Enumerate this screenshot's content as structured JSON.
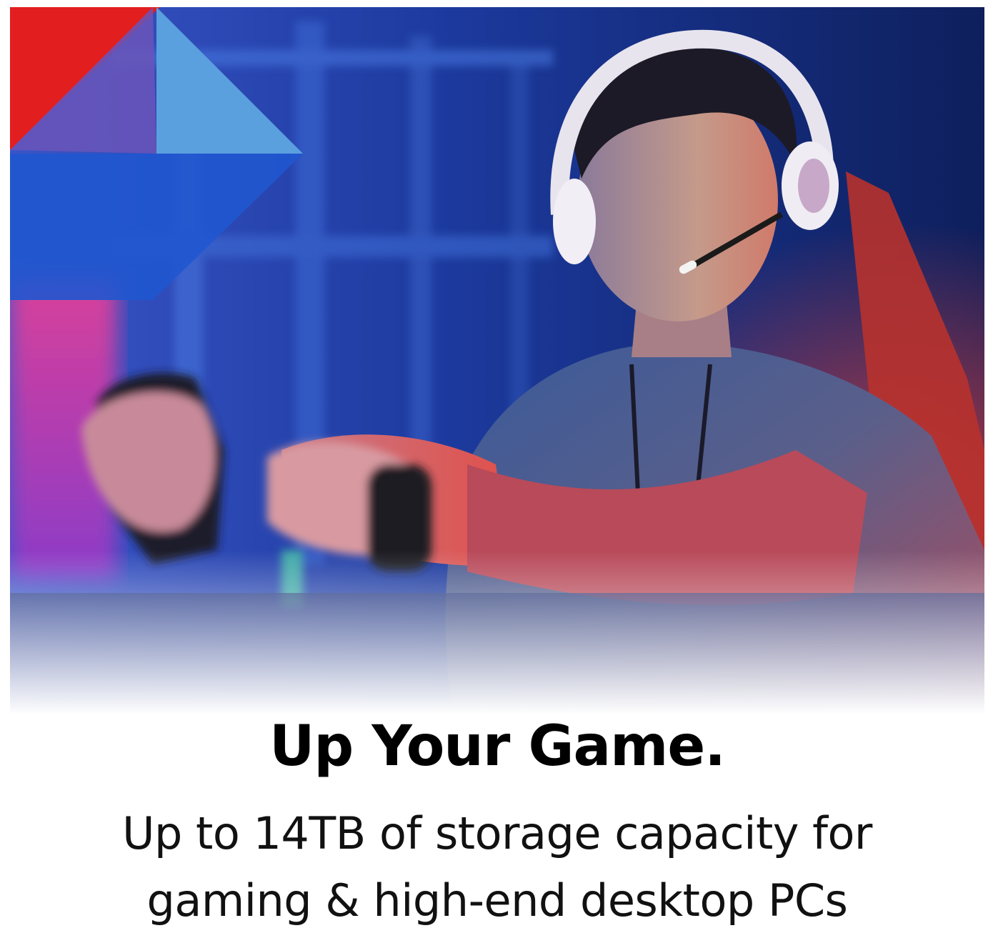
{
  "hero": {
    "headline": "Up Your Game.",
    "subline_line1": "Up to 14TB of storage capacity for",
    "subline_line2": "gaming & high-end desktop PCs"
  },
  "colors": {
    "brand_red": "#e31e1e",
    "brand_light_blue": "#5aa0de",
    "brand_blue": "#1d5fd0"
  }
}
